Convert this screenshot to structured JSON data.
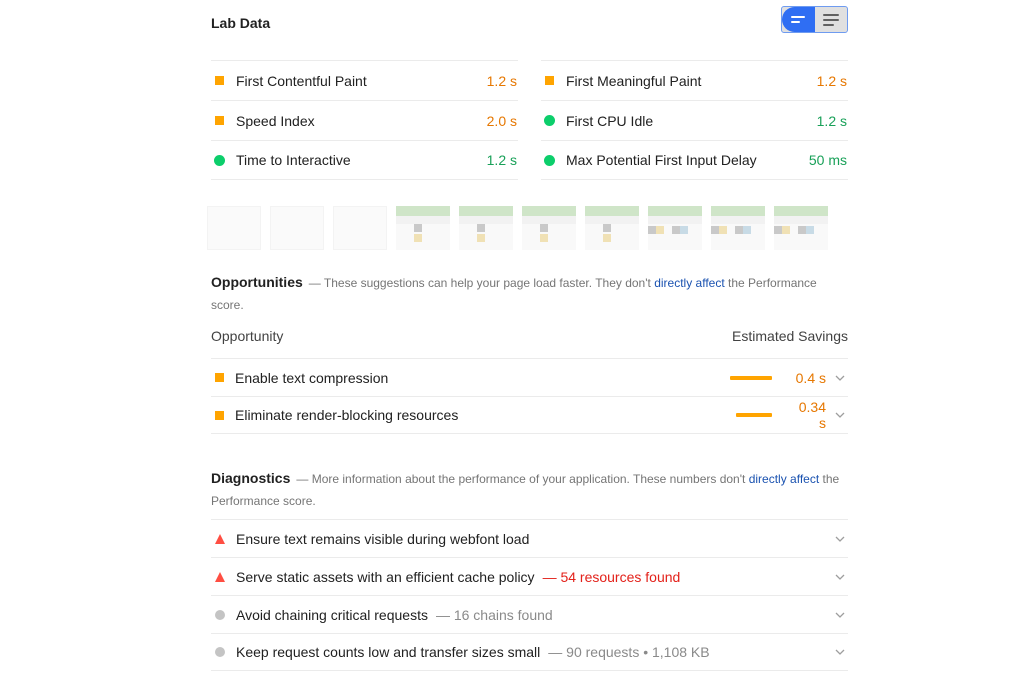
{
  "lab_data": {
    "title": "Lab Data",
    "view_toggle": {
      "options": [
        {
          "name": "compact-view",
          "icon": "compact-lines-icon",
          "active": true
        },
        {
          "name": "expanded-view",
          "icon": "list-lines-icon",
          "active": false
        }
      ]
    },
    "metrics": [
      {
        "label": "First Contentful Paint",
        "value": "1.2 s",
        "status": "average",
        "indicator": "square"
      },
      {
        "label": "First Meaningful Paint",
        "value": "1.2 s",
        "status": "average",
        "indicator": "square"
      },
      {
        "label": "Speed Index",
        "value": "2.0 s",
        "status": "average",
        "indicator": "square"
      },
      {
        "label": "First CPU Idle",
        "value": "1.2 s",
        "status": "pass",
        "indicator": "circle"
      },
      {
        "label": "Time to Interactive",
        "value": "1.2 s",
        "status": "pass",
        "indicator": "circle"
      },
      {
        "label": "Max Potential First Input Delay",
        "value": "50 ms",
        "status": "pass",
        "indicator": "circle"
      }
    ]
  },
  "filmstrip": {
    "frame_count": 10,
    "blank_frames": 3
  },
  "opportunities": {
    "title": "Opportunities",
    "desc_prefix": "— These suggestions can help your page load faster. They don't ",
    "desc_link": "directly affect",
    "desc_suffix": " the Performance score.",
    "col_left": "Opportunity",
    "col_right": "Estimated Savings",
    "items": [
      {
        "title": "Enable text compression",
        "savings": "0.4 s",
        "savings_fraction": 1.0
      },
      {
        "title": "Eliminate render-blocking resources",
        "savings": "0.34 s",
        "savings_fraction": 0.85
      }
    ]
  },
  "diagnostics": {
    "title": "Diagnostics",
    "desc_prefix": "— More information about the performance of your application. These numbers don't ",
    "desc_link": "directly affect",
    "desc_suffix": " the Performance score.",
    "items": [
      {
        "title": "Ensure text remains visible during webfont load",
        "detail": "",
        "status": "fail"
      },
      {
        "title": "Serve static assets with an efficient cache policy",
        "detail": "— 54 resources found",
        "status": "fail"
      },
      {
        "title": "Avoid chaining critical requests",
        "detail": "— 16 chains found",
        "status": "info"
      },
      {
        "title": "Keep request counts low and transfer sizes small",
        "detail": "— 90 requests • 1,108 KB",
        "status": "info"
      }
    ]
  },
  "colors": {
    "average": "#ffa400",
    "average_text": "#e67700",
    "pass": "#0cce6b",
    "pass_text": "#18a058",
    "fail": "#ff4e42",
    "link": "#1a52b0",
    "toggle_active": "#2f6ef3"
  }
}
